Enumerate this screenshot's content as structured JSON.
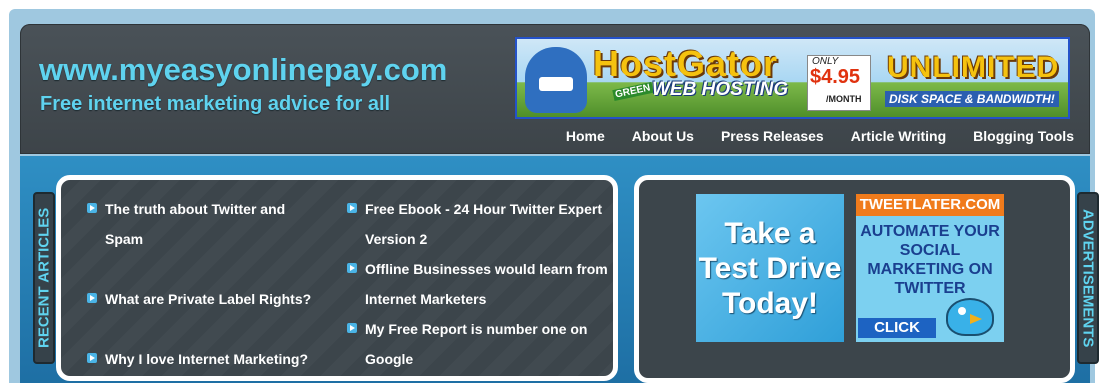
{
  "header": {
    "site_url": "www.myeasyonlinepay.com",
    "tagline": "Free internet marketing advice for all"
  },
  "banner": {
    "brand": "HostGator",
    "green": "GREEN",
    "web_hosting": "WEB HOSTING",
    "only": "ONLY",
    "price": "$4.95",
    "per_month": "/MONTH",
    "unlimited": "UNLIMITED",
    "disk": "DISK SPACE & BANDWIDTH!"
  },
  "nav": {
    "items": [
      "Home",
      "About Us",
      "Press Releases",
      "Article Writing",
      "Blogging Tools"
    ]
  },
  "recent_articles": {
    "tab_label": "RECENT ARTICLES",
    "column1": [
      "The truth about Twitter and Spam",
      "What are Private Label Rights?",
      "Why I love Internet Marketing?"
    ],
    "column2": [
      "Free Ebook - 24 Hour Twitter Expert Version 2",
      "Offline Businesses would learn from Internet Marketers",
      "My Free Report is number one on Google"
    ]
  },
  "advertisements": {
    "tab_label": "ADVERTISEMENTS",
    "ad1_text": "Take a Test Drive Today!",
    "ad2_top": "TWEETLATER.COM",
    "ad2_middle": "AUTOMATE YOUR SOCIAL MARKETING ON TWITTER",
    "ad2_button": "CLICK HERE"
  }
}
